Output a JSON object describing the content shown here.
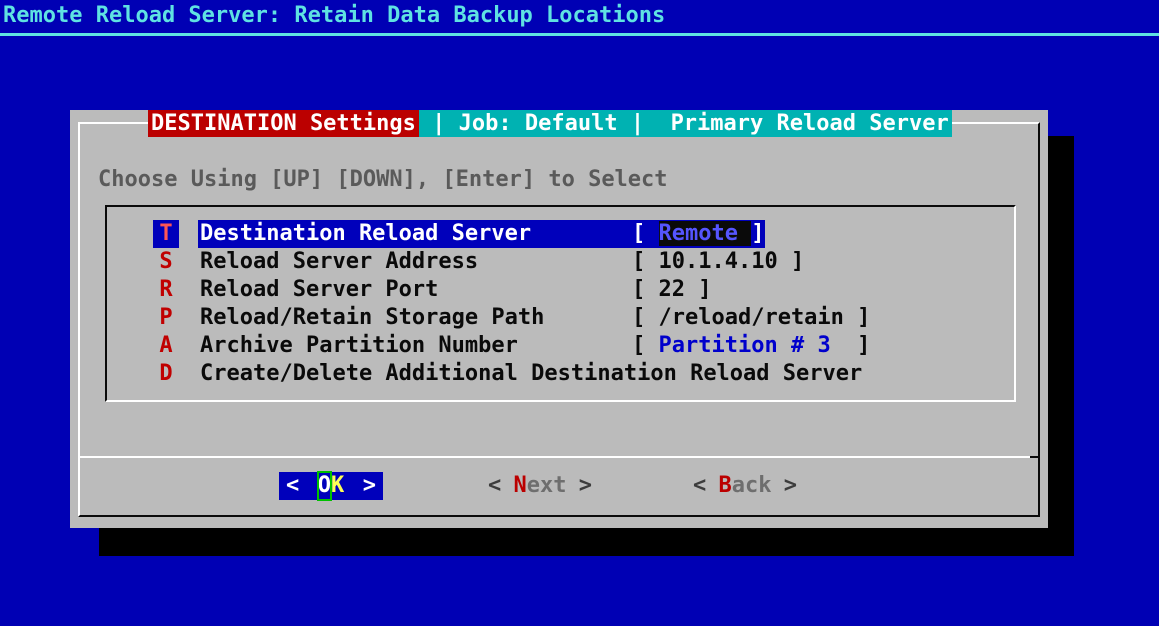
{
  "terminal": {
    "title": "Remote Reload Server: Retain Data Backup Locations"
  },
  "dialog": {
    "title_left": "DESTINATION Settings",
    "title_right": " | Job: Default |  Primary Reload Server",
    "instructions": "Choose Using [UP] [DOWN], [Enter] to Select",
    "menu": {
      "items": [
        {
          "hotkey": "T",
          "label": "Destination Reload Server",
          "value_open": "[ ",
          "value_text": "Remote ",
          "value_close": "]",
          "selected": true
        },
        {
          "hotkey": "S",
          "label": "Reload Server Address",
          "value": "[ 10.1.4.10 ]"
        },
        {
          "hotkey": "R",
          "label": "Reload Server Port",
          "value": "[ 22 ]"
        },
        {
          "hotkey": "P",
          "label": "Reload/Retain Storage Path",
          "value": "[ /reload/retain ]"
        },
        {
          "hotkey": "A",
          "label": "Archive Partition Number",
          "value_open": "[ ",
          "value_text": "Partition # 3",
          "value_close": "  ]"
        },
        {
          "hotkey": "D",
          "label": "Create/Delete Additional Destination Reload Server"
        }
      ]
    },
    "buttons": {
      "ok": {
        "open": "<",
        "cursor_char": "O",
        "rest": "K",
        "close": ">"
      },
      "next": {
        "open": "<",
        "hotkey": "N",
        "rest": "ext",
        "close": ">"
      },
      "back": {
        "open": "<",
        "hotkey": "B",
        "rest": "ack",
        "close": ">"
      }
    }
  },
  "colors": {
    "background_blue": "#0000B4",
    "dialog_gray": "#BBBBBB",
    "title_left_bg_red": "#BB0000",
    "title_right_bg_teal": "#00B2B2",
    "highlight_blue": "#0000BB",
    "accent_cyan": "#5FE2E2",
    "hotkey_red": "#C00000",
    "selected_hotkey_red": "#FF5555",
    "value_bright_blue": "#5555FF",
    "partition_blue": "#0000CC",
    "ok_yellow": "#FFFF55",
    "cursor_green": "#00C000"
  }
}
